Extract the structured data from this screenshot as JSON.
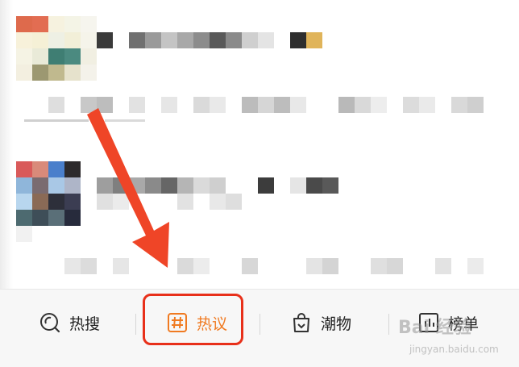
{
  "tabs": [
    {
      "label": "热搜",
      "icon": "search-spiral-icon",
      "active": false
    },
    {
      "label": "热议",
      "icon": "hashtag-box-icon",
      "active": true
    },
    {
      "label": "潮物",
      "icon": "shopping-bag-icon",
      "active": false
    },
    {
      "label": "榜单",
      "icon": "chart-box-icon",
      "active": false
    }
  ],
  "colors": {
    "active_tab": "#f07a21",
    "inactive_tab": "#222222",
    "highlight_box": "#e8301a",
    "arrow": "#ef4527",
    "tabbar_bg": "#f7f7f7"
  },
  "watermark": {
    "logo": "Bai 经验",
    "url": "jingyan.baidu.com"
  }
}
